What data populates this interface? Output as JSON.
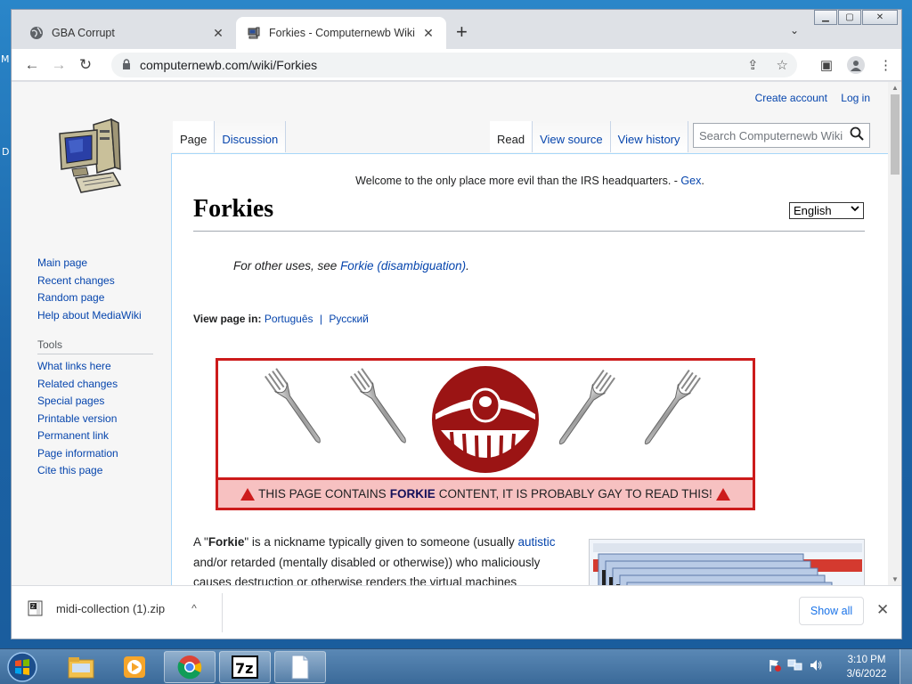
{
  "desktop": {
    "left_fragment_1": "M",
    "left_fragment_2": "D"
  },
  "browser": {
    "tabs": [
      {
        "title": "GBA Corrupt",
        "close": "✕"
      },
      {
        "title": "Forkies - Computernewb Wiki",
        "close": "✕"
      }
    ],
    "new_tab": "+",
    "tab_search": "⌄",
    "window_controls": {
      "minimize": "▁",
      "maximize": "▢",
      "close": "✕"
    },
    "nav": {
      "back": "←",
      "forward": "→",
      "reload": "↻"
    },
    "url": "computernewb.com/wiki/Forkies",
    "lock": "🔒",
    "omni_icons": {
      "share": "⇪",
      "bookmark": "☆"
    },
    "toolbar_icons": {
      "sidepanel": "▣",
      "profile": "●",
      "menu": "⋮"
    }
  },
  "wiki": {
    "personal": {
      "create_account": "Create account",
      "log_in": "Log in"
    },
    "tabs_left": [
      "Page",
      "Discussion"
    ],
    "tabs_right": [
      "Read",
      "View source",
      "View history"
    ],
    "search_placeholder": "Search Computernewb Wiki",
    "sidebar": {
      "nav": [
        "Main page",
        "Recent changes",
        "Random page",
        "Help about MediaWiki"
      ],
      "tools_heading": "Tools",
      "tools": [
        "What links here",
        "Related changes",
        "Special pages",
        "Printable version",
        "Permanent link",
        "Page information",
        "Cite this page"
      ]
    },
    "sitenotice": {
      "text": "Welcome to the only place more evil than the IRS headquarters. - ",
      "link": "Gex",
      "end": "."
    },
    "title": "Forkies",
    "language": "English",
    "hatnote": {
      "prefix": "For other uses, see ",
      "link": "Forkie (disambiguation)",
      "suffix": "."
    },
    "view_page_in": {
      "label": "View page in:",
      "langs": [
        "Português",
        "Русский"
      ],
      "sep": "|"
    },
    "warning": {
      "pre": "THIS PAGE CONTAINS ",
      "bold": "FORKIE",
      "post": " CONTENT, IT IS PROBABLY GAY TO READ THIS!"
    },
    "paragraph": {
      "p1": "A \"",
      "bold": "Forkie",
      "p2": "\" is a nickname typically given to someone (usually ",
      "link": "autistic",
      "p3": " and/or retarded (mentally disabled or otherwise)) who maliciously causes destruction or otherwise renders the virtual machines"
    }
  },
  "downloads": {
    "file": "midi-collection (1).zip",
    "caret": "^",
    "show_all": "Show all",
    "close": "✕"
  },
  "taskbar": {
    "time": "3:10 PM",
    "date": "3/6/2022"
  },
  "colors": {
    "accent": "#cc1b1b",
    "link": "#0645ad",
    "warn_bg": "#f7c1c1"
  }
}
